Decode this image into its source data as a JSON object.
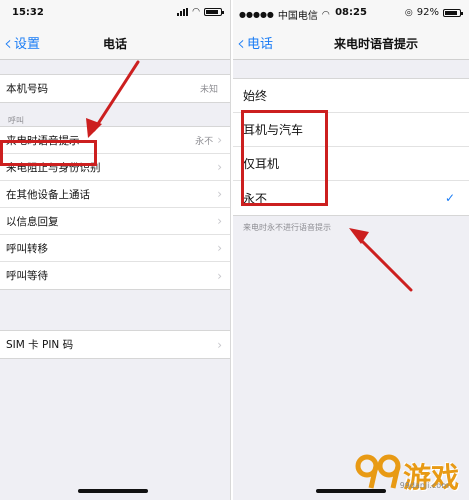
{
  "left": {
    "status": {
      "time": "15:32"
    },
    "nav": {
      "back_label": "设置",
      "title": "电话"
    },
    "my_number": {
      "label": "本机号码",
      "value": "未知"
    },
    "section_header": "呼叫",
    "items": [
      {
        "label": "来电时语音提示",
        "value": "永不"
      },
      {
        "label": "来电阻止与身份识别",
        "value": ""
      },
      {
        "label": "在其他设备上通话",
        "value": ""
      },
      {
        "label": "以信息回复",
        "value": ""
      },
      {
        "label": "呼叫转移",
        "value": ""
      },
      {
        "label": "呼叫等待",
        "value": ""
      }
    ],
    "sim_pin": {
      "label": "SIM 卡 PIN 码"
    }
  },
  "right": {
    "status": {
      "carrier": "中国电信",
      "time": "08:25",
      "battery": "92%"
    },
    "nav": {
      "back_label": "电话",
      "title": "来电时语音提示"
    },
    "options": [
      {
        "label": "始终",
        "selected": false
      },
      {
        "label": "耳机与汽车",
        "selected": false
      },
      {
        "label": "仅耳机",
        "selected": false
      },
      {
        "label": "永不",
        "selected": true
      }
    ],
    "footnote": "来电时永不进行语音提示"
  },
  "watermark": {
    "brand": "游戏",
    "sub": "99danji.com"
  },
  "colors": {
    "accent": "#1a7cf5",
    "highlight": "#cc1f1f",
    "watermark": "#e89a14"
  }
}
